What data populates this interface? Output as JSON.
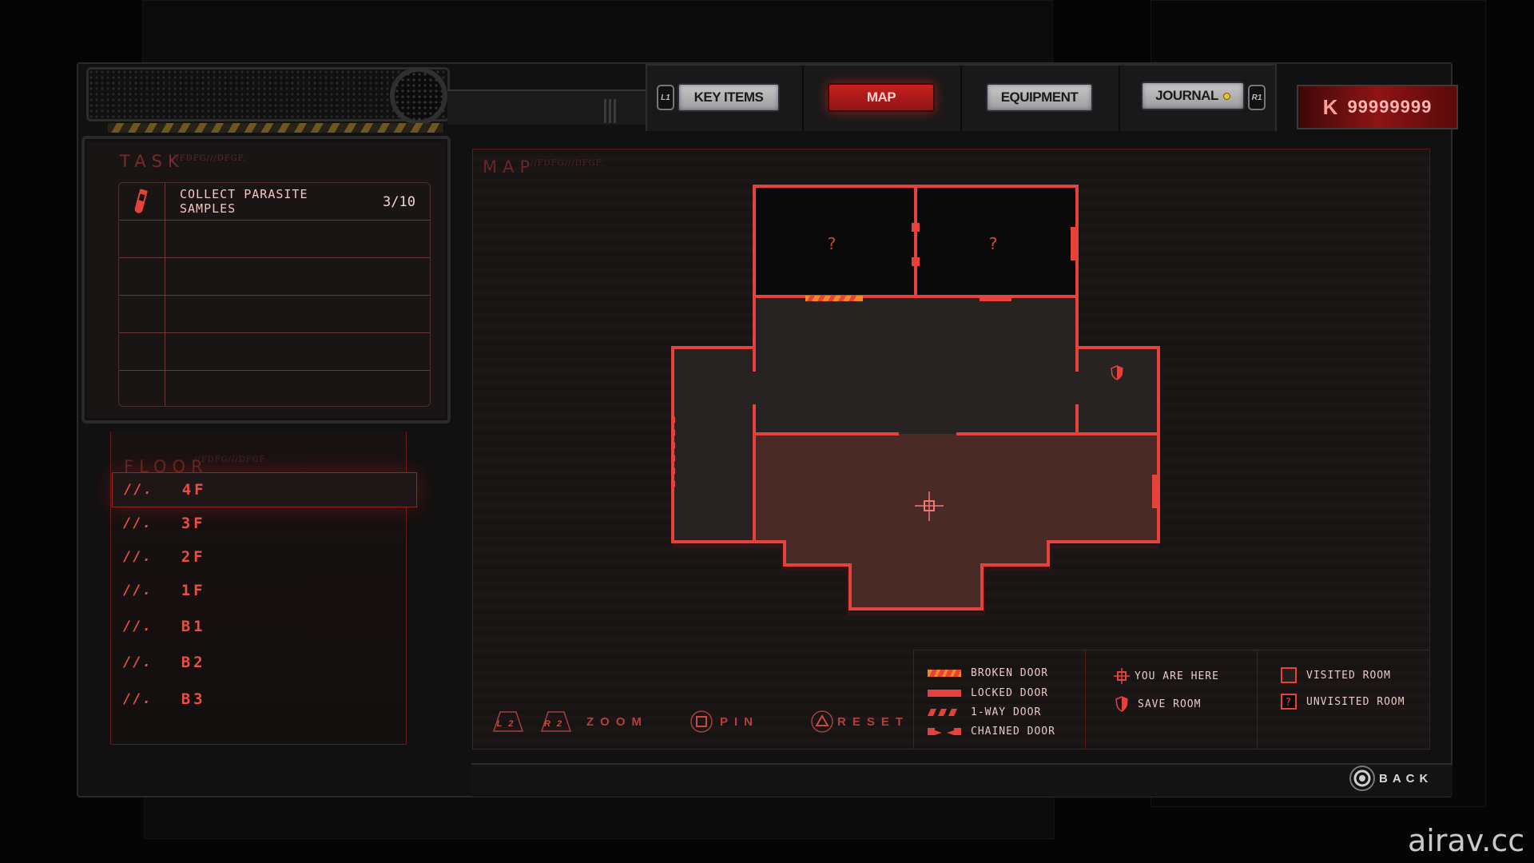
{
  "tabs": {
    "left_shoulder": "L1",
    "right_shoulder": "R1",
    "items": [
      {
        "label": "KEY ITEMS",
        "active": false
      },
      {
        "label": "MAP",
        "active": true
      },
      {
        "label": "EQUIPMENT",
        "active": false
      },
      {
        "label": "JOURNAL",
        "active": false,
        "notification": true
      }
    ]
  },
  "currency": {
    "symbol": "K",
    "amount": "99999999"
  },
  "task_panel": {
    "title": "TASK",
    "subtitle": "//FDFG///DFGF.",
    "tasks": [
      {
        "icon": "test-tube-icon",
        "name_line1": "COLLECT PARASITE",
        "name_line2": "SAMPLES",
        "progress": "3/10"
      }
    ],
    "empty_rows": 4
  },
  "floor_panel": {
    "title": "FLOOR",
    "subtitle": "//FDFG///DFGF.",
    "prefix": "//.",
    "floors": [
      {
        "label": "4F",
        "selected": true
      },
      {
        "label": "3F",
        "selected": false
      },
      {
        "label": "2F",
        "selected": false
      },
      {
        "label": "1F",
        "selected": false
      },
      {
        "label": "B1",
        "selected": false
      },
      {
        "label": "B2",
        "selected": false
      },
      {
        "label": "B3",
        "selected": false
      }
    ]
  },
  "map_panel": {
    "title": "MAP",
    "subtitle": "//FDFG///DFGF.",
    "unvisited_marker": "?",
    "rooms": [
      {
        "id": "top-left",
        "status": "unvisited"
      },
      {
        "id": "top-right",
        "status": "unvisited"
      },
      {
        "id": "central-hall",
        "status": "visited"
      },
      {
        "id": "west-wing",
        "status": "visited"
      },
      {
        "id": "east-save-room",
        "status": "visited",
        "save_room": true
      },
      {
        "id": "lower-hall",
        "status": "current"
      }
    ],
    "doors": [
      {
        "type": "broken",
        "between": "top-left / central-hall"
      },
      {
        "type": "locked",
        "between": "top-right / central-hall"
      },
      {
        "type": "chained",
        "between": "top-left / top-right"
      },
      {
        "type": "locked",
        "between": "top-right / east"
      },
      {
        "type": "one-way",
        "between": "west-wing / west"
      },
      {
        "type": "locked",
        "between": "lower-hall / east"
      }
    ]
  },
  "controls": {
    "zoom": {
      "buttons": [
        "L2",
        "R2"
      ],
      "label": "ZOOM"
    },
    "pin": {
      "label": "PIN"
    },
    "reset": {
      "label": "RESET"
    }
  },
  "legend": {
    "doors": [
      "BROKEN DOOR",
      "LOCKED DOOR",
      "1-WAY DOOR",
      "CHAINED DOOR"
    ],
    "markers": [
      "YOU ARE HERE",
      "SAVE ROOM"
    ],
    "rooms": [
      "VISITED ROOM",
      "UNVISITED ROOM"
    ]
  },
  "back": {
    "label": "BACK"
  },
  "watermark": "airav.cc",
  "colors": {
    "accent": "#e5423b",
    "broken_door": "#f08a24",
    "current_room": "#4a2a26",
    "visited_room": "#272322",
    "unvisited_room": "#0a0909"
  }
}
